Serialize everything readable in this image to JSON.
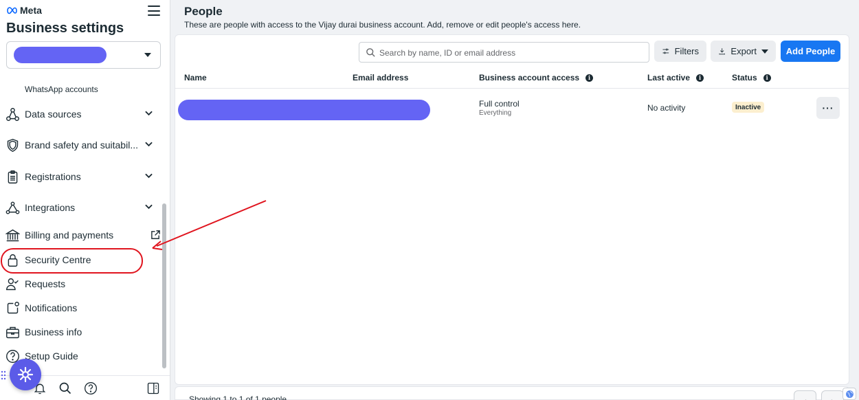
{
  "sidebar": {
    "brand": "Meta",
    "title": "Business settings",
    "sub_item": "WhatsApp accounts",
    "items": [
      {
        "label": "Data sources",
        "icon": "data-sources-icon"
      },
      {
        "label": "Brand safety and suitabil...",
        "icon": "shield-icon"
      },
      {
        "label": "Registrations",
        "icon": "clipboard-icon"
      },
      {
        "label": "Integrations",
        "icon": "integrations-icon"
      },
      {
        "label": "Billing and payments",
        "icon": "bank-icon"
      },
      {
        "label": "Security Centre",
        "icon": "lock-icon"
      },
      {
        "label": "Requests",
        "icon": "person-check-icon"
      },
      {
        "label": "Notifications",
        "icon": "notification-icon"
      },
      {
        "label": "Business info",
        "icon": "briefcase-icon"
      },
      {
        "label": "Setup Guide",
        "icon": "question-icon"
      }
    ]
  },
  "header": {
    "title": "People",
    "description": "These are people with access to the Vijay durai business account. Add, remove or edit people's access here."
  },
  "toolbar": {
    "search_placeholder": "Search by name, ID or email address",
    "filters_label": "Filters",
    "export_label": "Export",
    "add_label": "Add People"
  },
  "table": {
    "columns": [
      "Name",
      "Email address",
      "Business account access",
      "Last active",
      "Status"
    ],
    "rows": [
      {
        "access": "Full control",
        "access_detail": "Everything",
        "last_active": "No activity",
        "status": "Inactive"
      }
    ]
  },
  "footer": {
    "showing": "Showing 1 to 1 of 1 people"
  },
  "colors": {
    "accent": "#1877f2",
    "redaction": "#6464f4",
    "annotation": "#e0141e",
    "inactive_badge": "#fcefcf"
  }
}
